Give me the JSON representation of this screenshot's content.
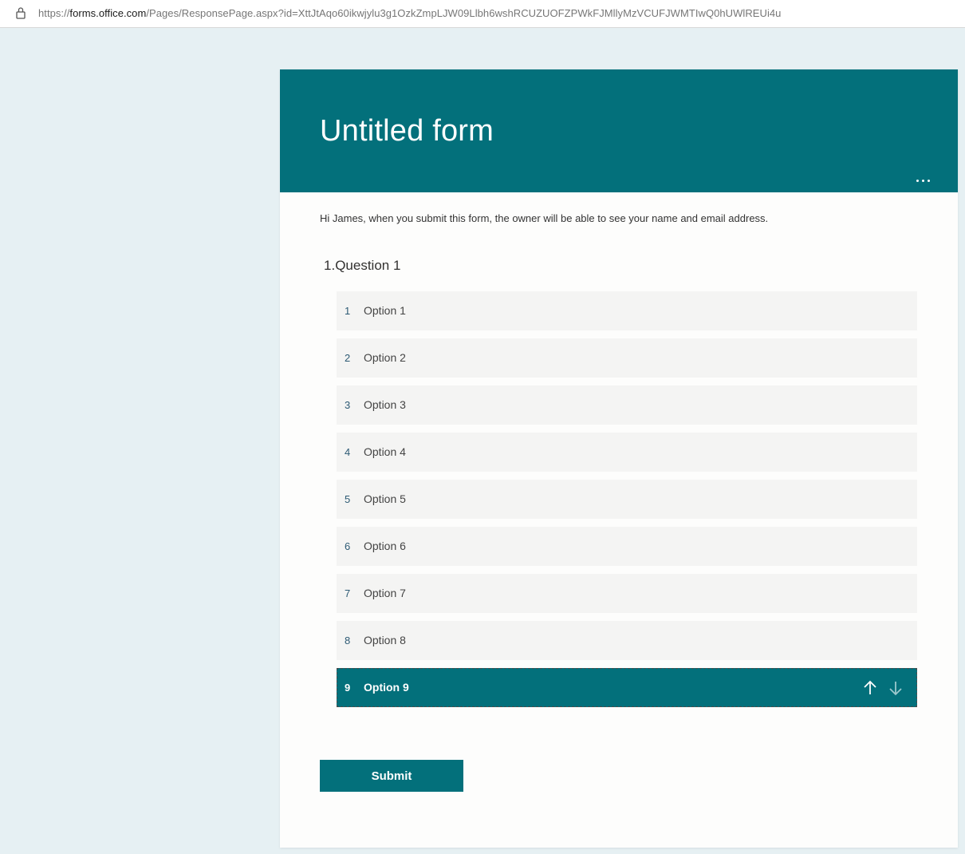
{
  "browser": {
    "url_prefix": "https://",
    "url_host": "forms.office.com",
    "url_path": "/Pages/ResponsePage.aspx?id=XttJtAqo60ikwjylu3g1OzkZmpLJW09Llbh6wshRCUZUOFZPWkFJMllyMzVCUFJWMTIwQ0hUWlREUi4u",
    "lock_icon": "lock-icon"
  },
  "form": {
    "title": "Untitled form",
    "more_icon": "ellipsis-icon",
    "notice": "Hi James, when you submit this form, the owner will be able to see your name and email address.",
    "question": {
      "number": "1.",
      "text": "Question 1",
      "options": [
        {
          "rank": "1",
          "label": "Option 1"
        },
        {
          "rank": "2",
          "label": "Option 2"
        },
        {
          "rank": "3",
          "label": "Option 3"
        },
        {
          "rank": "4",
          "label": "Option 4"
        },
        {
          "rank": "5",
          "label": "Option 5"
        },
        {
          "rank": "6",
          "label": "Option 6"
        },
        {
          "rank": "7",
          "label": "Option 7"
        },
        {
          "rank": "8",
          "label": "Option 8"
        },
        {
          "rank": "9",
          "label": "Option 9"
        }
      ],
      "selected_index": 8
    },
    "submit_label": "Submit"
  },
  "colors": {
    "accent": "#03707b",
    "page_background": "#e6f0f3",
    "option_background": "#f4f4f3"
  }
}
